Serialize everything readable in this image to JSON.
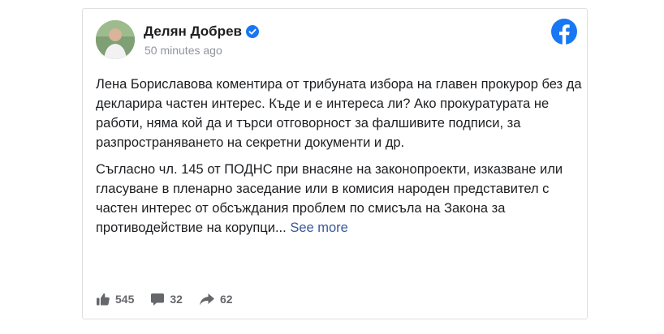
{
  "post": {
    "author": "Делян Добрев",
    "timestamp": "50 minutes ago",
    "paragraph1": "Лена Бориславова коментира от трибуната избора на главен прокурор без да декларира частен интерес. Къде и е интереса ли? Ако прокуратурата не работи, няма кой да и търси отговорност за фалшивите подписи, за разпространяването на секретни документи и др.",
    "paragraph2": "Съгласно чл. 145 от ПОДНС при внасяне на законопроекти, изказване или гласуване в пленарно заседание или в комисия народен представител с частен интерес от обсъждания проблем по смисъла на Закона за противодействие на корупци...",
    "see_more": "See more"
  },
  "actions": {
    "likes": "545",
    "comments": "32",
    "shares": "62"
  },
  "colors": {
    "brand": "#1877f2",
    "link": "#385898",
    "muted": "#90949c"
  },
  "icons": [
    "verified-badge-icon",
    "facebook-logo-icon",
    "like-icon",
    "comment-icon",
    "share-icon"
  ]
}
